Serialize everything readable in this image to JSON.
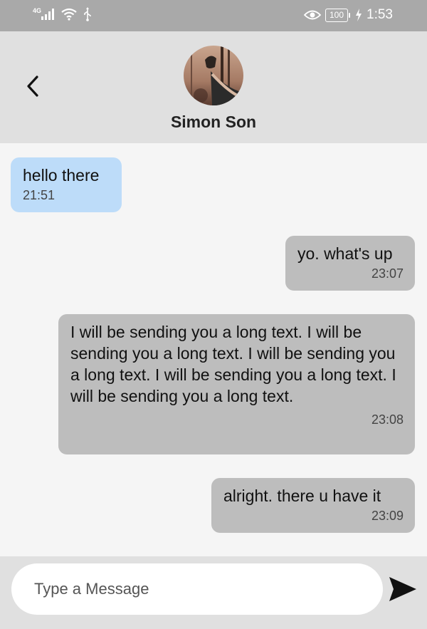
{
  "status_bar": {
    "network": "4G",
    "battery": "100",
    "time": "1:53"
  },
  "header": {
    "contact_name": "Simon Son",
    "back_icon": "chevron-left-icon",
    "avatar": "contact-avatar-photo"
  },
  "messages": [
    {
      "direction": "incoming",
      "text": "hello there",
      "time": "21:51"
    },
    {
      "direction": "outgoing",
      "text": "yo. what's up",
      "time": "23:07"
    },
    {
      "direction": "outgoing",
      "text": "I will be sending you a long text. I will be sending you a long text. I will be sending you a long text. I will be sending you a long text. I will be sending you a long text.",
      "time": "23:08"
    },
    {
      "direction": "outgoing",
      "text": "alright. there u have it",
      "time": "23:09"
    }
  ],
  "composer": {
    "placeholder": "Type a Message",
    "value": "",
    "send_icon": "send-icon"
  },
  "colors": {
    "status_bar": "#a9a9a9",
    "header": "#e0e0e0",
    "incoming_bubble": "#bddcf9",
    "outgoing_bubble": "#bdbdbd",
    "background": "#f5f5f5"
  }
}
